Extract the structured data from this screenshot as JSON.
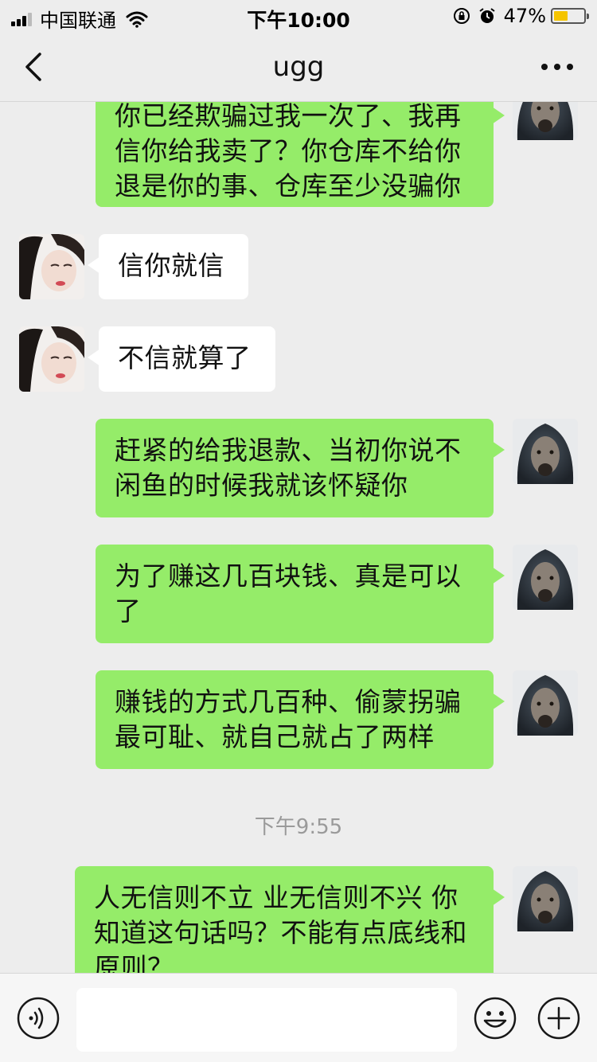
{
  "status_bar": {
    "carrier": "中国联通",
    "time": "下午10:00",
    "battery_percent": "47%",
    "battery_level": 0.47
  },
  "header": {
    "title": "ugg"
  },
  "messages": [
    {
      "side": "out",
      "text": "你已经欺骗过我一次了、我再信你给我卖了？你仓库不给你退是你的事、仓库至少没骗你"
    },
    {
      "side": "in",
      "text": "信你就信"
    },
    {
      "side": "in",
      "text": "不信就算了"
    },
    {
      "side": "out",
      "text": "赶紧的给我退款、当初你说不闲鱼的时候我就该怀疑你"
    },
    {
      "side": "out",
      "text": "为了赚这几百块钱、真是可以了"
    },
    {
      "side": "out",
      "text": "赚钱的方式几百种、偷蒙拐骗最可耻、就自己就占了两样"
    },
    {
      "side": "out",
      "text": "人无信则不立 业无信则不兴  你知道这句话吗？不能有点底线和原则？"
    }
  ],
  "timestamp": "下午9:55",
  "input": {
    "value": "",
    "placeholder": ""
  },
  "colors": {
    "outgoing_bubble": "#95ec69",
    "incoming_bubble": "#ffffff",
    "background": "#ededed"
  }
}
